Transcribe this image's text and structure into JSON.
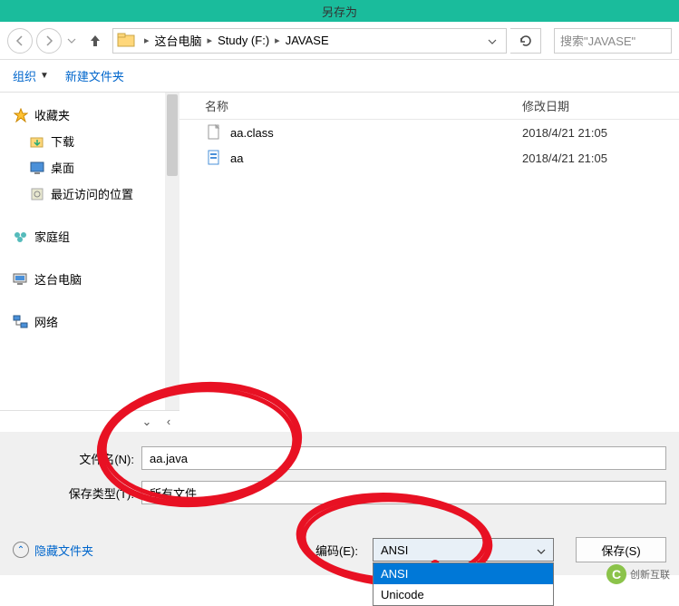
{
  "window": {
    "title": "另存为"
  },
  "breadcrumb": {
    "items": [
      "这台电脑",
      "Study (F:)",
      "JAVASE"
    ]
  },
  "search": {
    "placeholder": "搜索\"JAVASE\""
  },
  "toolbar": {
    "organize": "组织",
    "newfolder": "新建文件夹"
  },
  "sidebar": {
    "favorites": "收藏夹",
    "downloads": "下载",
    "desktop": "桌面",
    "recent": "最近访问的位置",
    "homegroup": "家庭组",
    "thispc": "这台电脑",
    "network": "网络"
  },
  "columns": {
    "name": "名称",
    "date": "修改日期"
  },
  "files": [
    {
      "name": "aa.class",
      "date": "2018/4/21 21:05",
      "type": "file"
    },
    {
      "name": "aa",
      "date": "2018/4/21 21:05",
      "type": "code"
    }
  ],
  "form": {
    "filename_label": "文件名(N):",
    "filename_value": "aa.java",
    "savetype_label": "保存类型(T):",
    "savetype_value": "所有文件"
  },
  "footer": {
    "hide_folders": "隐藏文件夹",
    "encoding_label": "编码(E):",
    "encoding_value": "ANSI",
    "encoding_options": [
      "ANSI",
      "Unicode"
    ],
    "save": "保存(S)"
  },
  "watermark": {
    "text": "创新互联"
  }
}
